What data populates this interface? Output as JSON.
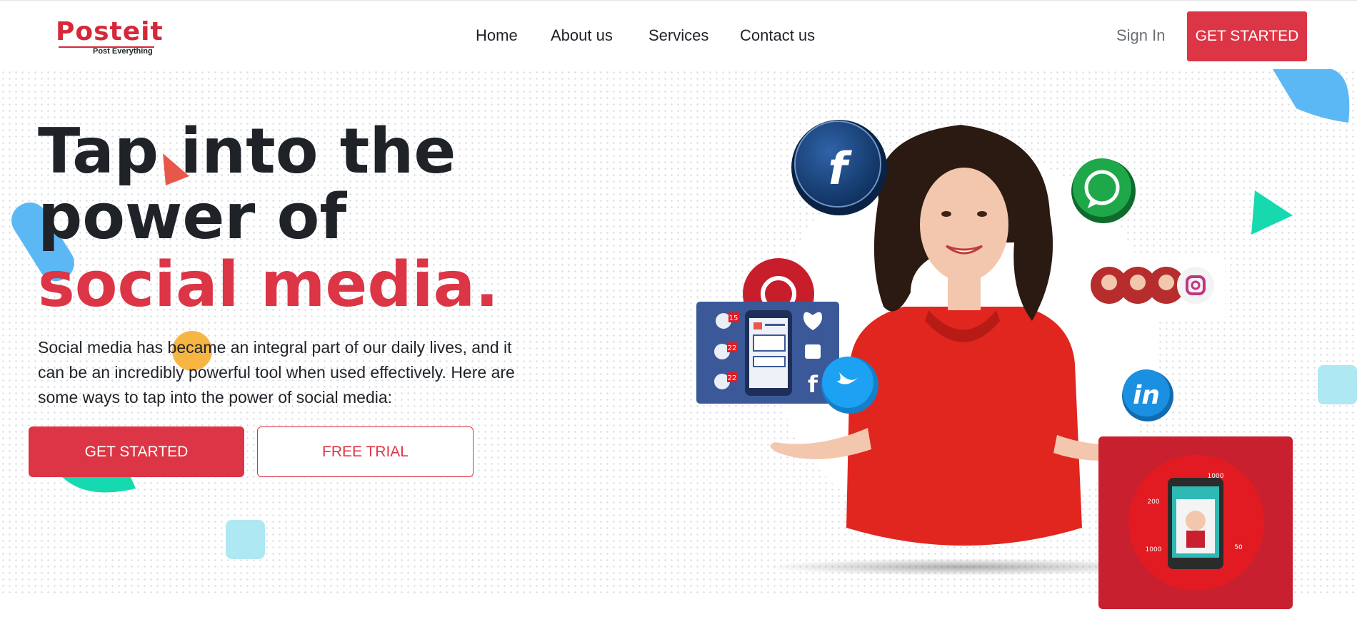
{
  "header": {
    "logo_text": "Posteit",
    "logo_tagline": "Post Everything",
    "nav": [
      {
        "label": "Home"
      },
      {
        "label": "About us"
      },
      {
        "label": "Services"
      },
      {
        "label": "Contact us"
      }
    ],
    "signin_label": "Sign In",
    "cta_label": "GET STARTED"
  },
  "hero": {
    "headline_line1": "Tap into the",
    "headline_line2": "power of",
    "headline_line3": "social media.",
    "paragraph": "Social media has became an integral part of our daily lives, and it can be an incredibly powerful tool when used effectively. Here are some ways to tap into the power of social media:",
    "primary_button": "GET STARTED",
    "secondary_button": "FREE TRIAL"
  },
  "illustration": {
    "badges": [
      "15",
      "22",
      "22"
    ],
    "phone_counts": [
      "1000",
      "200",
      "1000",
      "50"
    ]
  },
  "colors": {
    "brand_red": "#dc3545",
    "text_dark": "#1f2328",
    "facebook_blue": "#1b4a86",
    "whatsapp_green": "#1fa84a",
    "linkedin_blue": "#1b8fe0",
    "twitter_blue": "#1da1f2"
  },
  "icons": [
    "facebook-icon",
    "whatsapp-icon",
    "twitter-icon",
    "linkedin-icon",
    "instagram-icon",
    "pinterest-icon",
    "heart-icon",
    "thumbs-up-icon"
  ]
}
